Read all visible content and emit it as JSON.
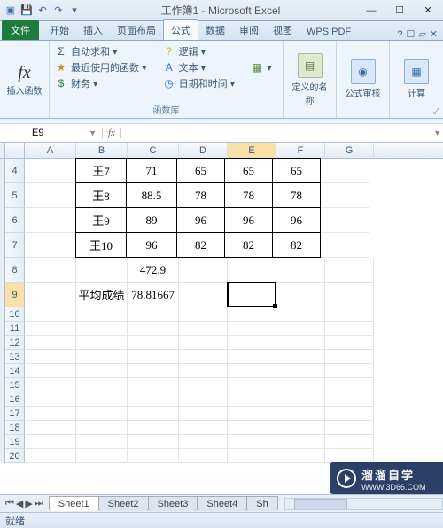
{
  "app": {
    "title": "工作簿1 - Microsoft Excel"
  },
  "wincontrols": {
    "min": "—",
    "max": "☐",
    "close": "✕"
  },
  "tabs": {
    "file": "文件",
    "items": [
      "开始",
      "插入",
      "页面布局",
      "公式",
      "数据",
      "审阅",
      "视图",
      "WPS PDF"
    ]
  },
  "ribbon": {
    "insert_fn": "插入函数",
    "autosum": "自动求和 ▾",
    "recent": "最近使用的函数 ▾",
    "financial": "财务 ▾",
    "logic": "逻辑 ▾",
    "text": "文本 ▾",
    "datetime": "日期和时间 ▾",
    "lib_label": "函数库",
    "define_name": "定义的名称",
    "formula_audit": "公式审核",
    "calc": "计算"
  },
  "namebox": {
    "ref": "E9"
  },
  "columns": [
    "A",
    "B",
    "C",
    "D",
    "E",
    "F",
    "G"
  ],
  "rownums": {
    "r4": "4",
    "r5": "5",
    "r6": "6",
    "r7": "7",
    "r8": "8",
    "r9": "9",
    "r10": "10",
    "r11": "11",
    "r12": "12",
    "r13": "13",
    "r14": "14",
    "r15": "15",
    "r16": "16",
    "r17": "17",
    "r18": "18",
    "r19": "19",
    "r20": "20"
  },
  "cells": {
    "B4": "王7",
    "C4": "71",
    "D4": "65",
    "E4": "65",
    "F4": "65",
    "B5": "王8",
    "C5": "88.5",
    "D5": "78",
    "E5": "78",
    "F5": "78",
    "B6": "王9",
    "C6": "89",
    "D6": "96",
    "E6": "96",
    "F6": "96",
    "B7": "王10",
    "C7": "96",
    "D7": "82",
    "E7": "82",
    "F7": "82",
    "C8": "472.9",
    "B9": "平均成绩",
    "C9": "78.81667"
  },
  "sheets": [
    "Sheet1",
    "Sheet2",
    "Sheet3",
    "Sheet4",
    "Sh"
  ],
  "status": {
    "ready": "就绪"
  },
  "watermark": {
    "name": "溜溜自学",
    "url": "WWW.3D66.COM"
  }
}
